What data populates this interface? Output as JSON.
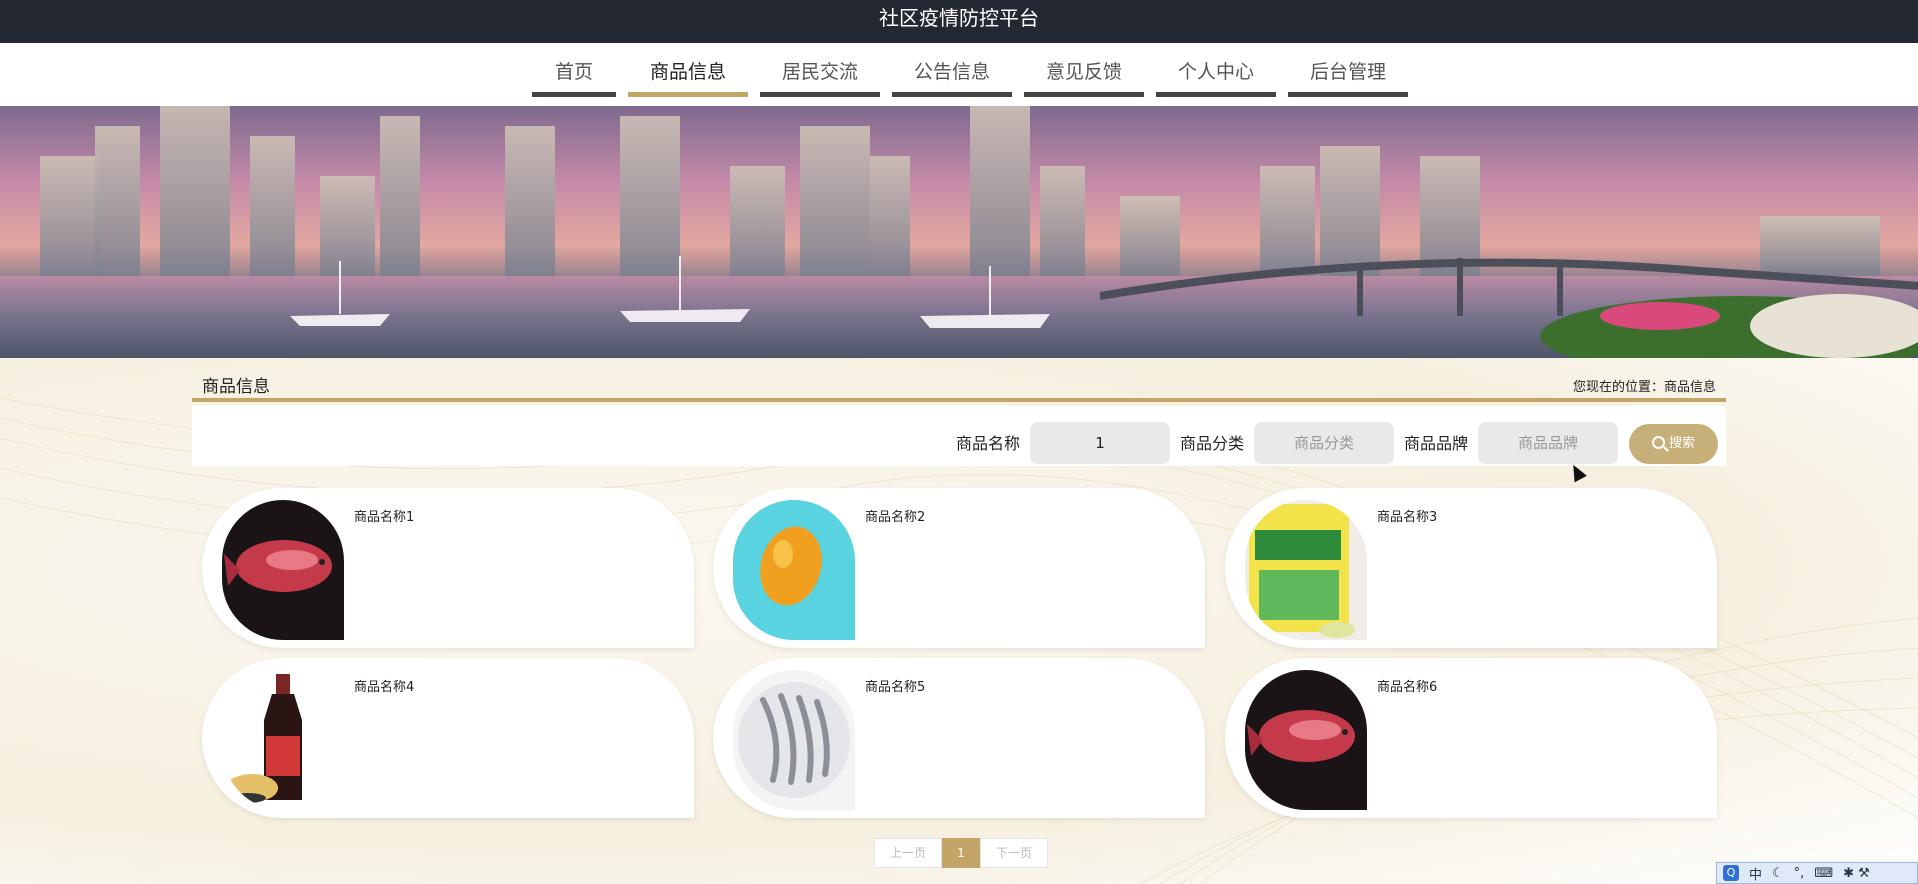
{
  "header": {
    "title": "社区疫情防控平台"
  },
  "nav": {
    "items": [
      {
        "label": "首页"
      },
      {
        "label": "商品信息"
      },
      {
        "label": "居民交流"
      },
      {
        "label": "公告信息"
      },
      {
        "label": "意见反馈"
      },
      {
        "label": "个人中心"
      },
      {
        "label": "后台管理"
      }
    ],
    "active": "商品信息"
  },
  "section": {
    "title": "商品信息",
    "breadcrumb": "您现在的位置：商品信息"
  },
  "search": {
    "name_label": "商品名称",
    "name_value": "1",
    "category_label": "商品分类",
    "category_placeholder": "商品分类",
    "brand_label": "商品品牌",
    "brand_placeholder": "商品品牌",
    "button_label": "搜索"
  },
  "products": [
    {
      "name": "商品名称1",
      "image": "red-arowana-fish"
    },
    {
      "name": "商品名称2",
      "image": "lemon"
    },
    {
      "name": "商品名称3",
      "image": "seasoning-bag"
    },
    {
      "name": "商品名称4",
      "image": "soy-sauce-bottle"
    },
    {
      "name": "商品名称5",
      "image": "shrimp-plate"
    },
    {
      "name": "商品名称6",
      "image": "red-arowana-fish"
    }
  ],
  "pagination": {
    "prev": "上一页",
    "current": "1",
    "next": "下一页"
  },
  "ime": {
    "icon": "Q",
    "lang": "中",
    "moon": "☾",
    "punct": "°,",
    "keyboard": "⌨",
    "tools": "✱ ⚒"
  },
  "colors": {
    "accent": "#c2a567",
    "topbar": "#232833",
    "search_button": "#c7af79"
  }
}
